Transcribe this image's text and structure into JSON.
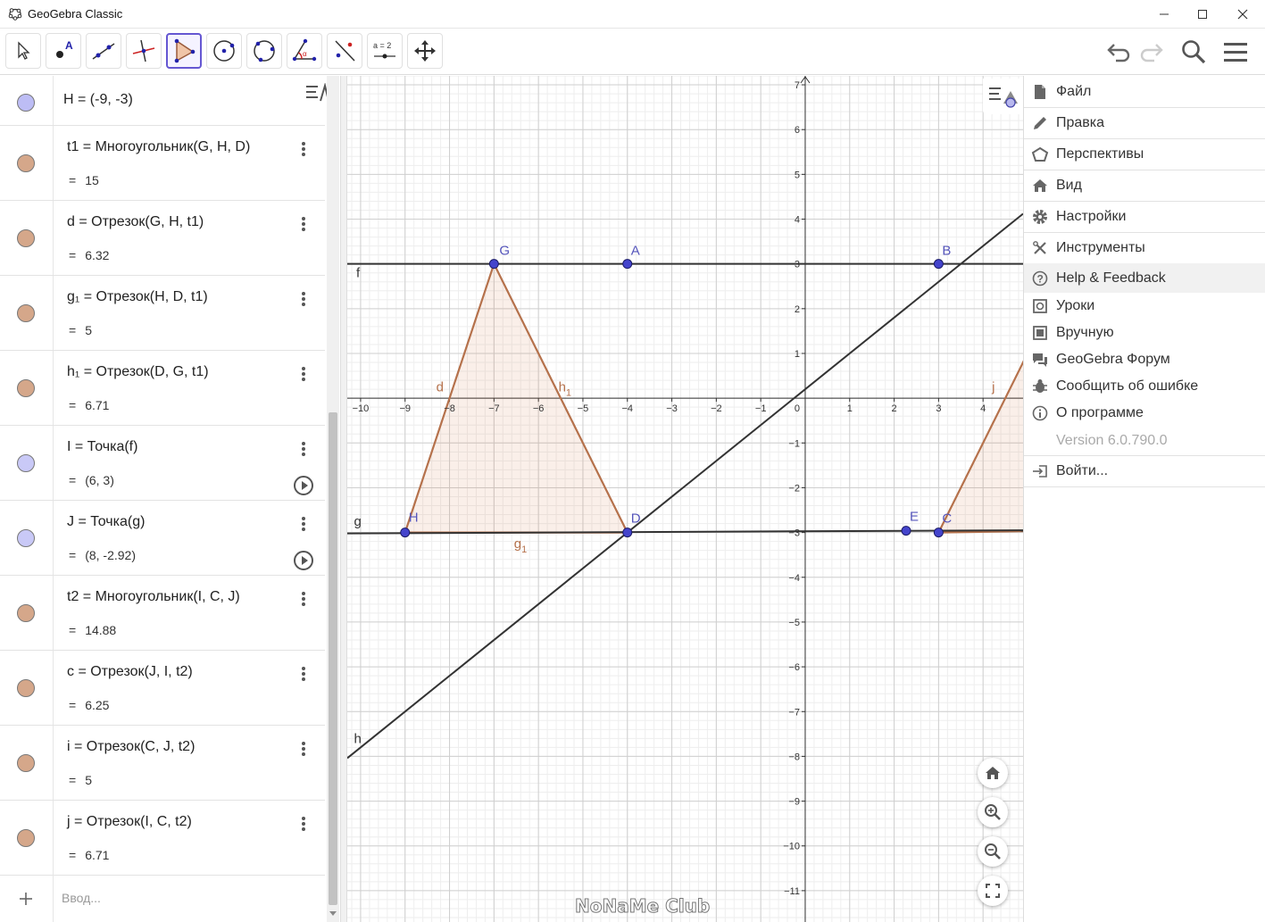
{
  "window": {
    "title": "GeoGebra Classic"
  },
  "toolbar": {
    "tools": [
      "move",
      "point",
      "line",
      "perpendicular",
      "polygon",
      "circle",
      "conic",
      "angle",
      "reflect",
      "slider",
      "move-graphics"
    ],
    "slider_label": "a = 2",
    "undo": "undo",
    "redo": "redo",
    "search": "search",
    "menu": "menu"
  },
  "algebra": {
    "rows": [
      {
        "name": "H",
        "def": "H = (-9, -3)",
        "value": "",
        "color": "#bdbdf5",
        "play": false,
        "partial": true
      },
      {
        "name": "t1",
        "def": "t1 = Многоугольник(G, H, D)",
        "value": "15",
        "color": "#d5a78a"
      },
      {
        "name": "d",
        "def": "d = Отрезок(G, H, t1)",
        "value": "6.32",
        "color": "#d5a78a"
      },
      {
        "name": "g1",
        "def": "g₁ = Отрезок(H, D, t1)",
        "value": "5",
        "color": "#d5a78a"
      },
      {
        "name": "h1",
        "def": "h₁ = Отрезок(D, G, t1)",
        "value": "6.71",
        "color": "#d5a78a"
      },
      {
        "name": "I",
        "def": "I = Точка(f)",
        "value": "(6, 3)",
        "color": "#c9c9f7",
        "play": true
      },
      {
        "name": "J",
        "def": "J = Точка(g)",
        "value": "(8, -2.92)",
        "color": "#c9c9f7",
        "play": true
      },
      {
        "name": "t2",
        "def": "t2 = Многоугольник(I, C, J)",
        "value": "14.88",
        "color": "#d5a78a"
      },
      {
        "name": "c",
        "def": "c = Отрезок(J, I, t2)",
        "value": "6.25",
        "color": "#d5a78a"
      },
      {
        "name": "i",
        "def": "i = Отрезок(C, J, t2)",
        "value": "5",
        "color": "#d5a78a"
      },
      {
        "name": "j",
        "def": "j = Отрезок(I, C, t2)",
        "value": "6.71",
        "color": "#d5a78a"
      }
    ],
    "input_placeholder": "Ввод..."
  },
  "graphics": {
    "x_range": [
      -10.3,
      4.9
    ],
    "y_range": [
      -11.7,
      7.2
    ],
    "x_ticks": [
      -10,
      -9,
      -8,
      -7,
      -6,
      -5,
      -4,
      -3,
      -2,
      -1,
      0,
      1,
      2,
      3,
      4
    ],
    "y_ticks": [
      -11,
      -10,
      -9,
      -8,
      -7,
      -6,
      -5,
      -4,
      -3,
      -2,
      -1,
      1,
      2,
      3,
      4,
      5,
      6,
      7
    ],
    "points": [
      {
        "label": "G",
        "x": -7,
        "y": 3
      },
      {
        "label": "A",
        "x": -4,
        "y": 3
      },
      {
        "label": "B",
        "x": 3,
        "y": 3
      },
      {
        "label": "H",
        "x": -9,
        "y": -3
      },
      {
        "label": "D",
        "x": -4,
        "y": -3
      },
      {
        "label": "E",
        "x": 2.27,
        "y": -2.96
      },
      {
        "label": "C",
        "x": 3,
        "y": -3
      }
    ],
    "line_labels": [
      "f",
      "g",
      "h",
      "d",
      "h1",
      "g1",
      "j"
    ],
    "colors": {
      "polygon": "#b5714b",
      "point": "#4444cc",
      "line": "#333333",
      "grid": "#e0e0e0"
    }
  },
  "menu": {
    "items": [
      "Файл",
      "Правка",
      "Перспективы",
      "Вид",
      "Настройки",
      "Инструменты",
      "Help & Feedback"
    ],
    "sub_items": [
      "Уроки",
      "Вручную",
      "GeoGebra Форум",
      "Сообщить об ошибке",
      "О программе"
    ],
    "version": "Version 6.0.790.0",
    "login": "Войти..."
  },
  "watermark": "NoNaMe Club"
}
